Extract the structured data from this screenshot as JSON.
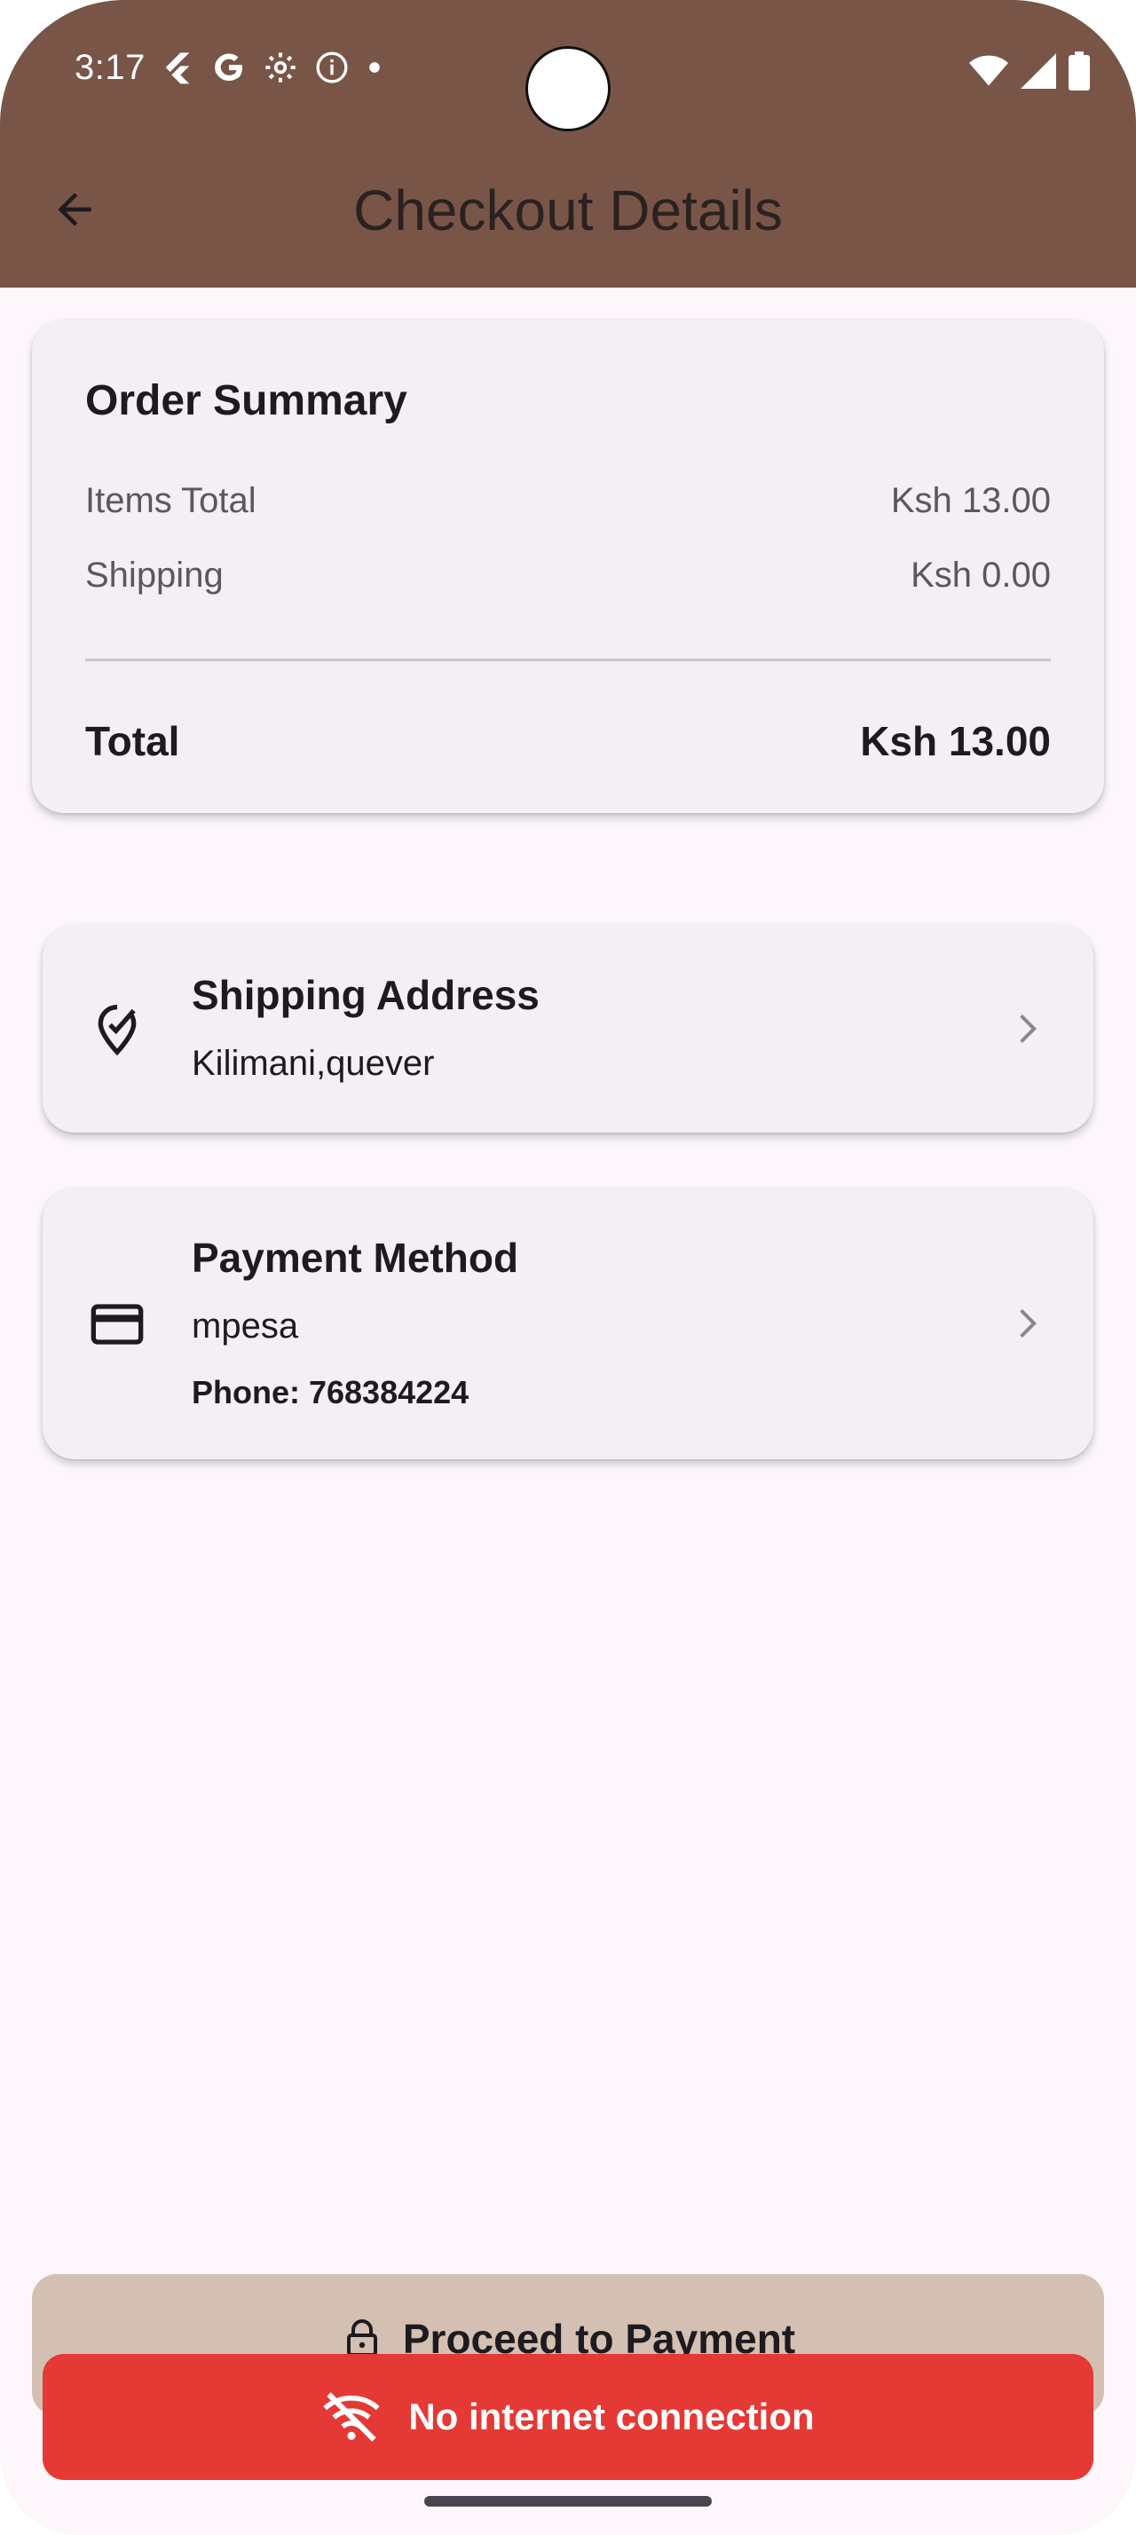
{
  "status_bar": {
    "time": "3:17",
    "left_icons": [
      "flutter-icon",
      "google-icon",
      "settings-icon",
      "info-icon",
      "dot-icon"
    ],
    "right_icons": [
      "wifi-icon",
      "signal-icon",
      "battery-icon"
    ]
  },
  "app_bar": {
    "title": "Checkout Details",
    "background": "#795548",
    "back_icon": "arrow-back-icon"
  },
  "order_summary": {
    "title": "Order Summary",
    "items_total_label": "Items Total",
    "items_total_value": "Ksh 13.00",
    "shipping_label": "Shipping",
    "shipping_value": "Ksh 0.00",
    "total_label": "Total",
    "total_value": "Ksh 13.00"
  },
  "shipping_address": {
    "title": "Shipping Address",
    "value": "Kilimani,quever",
    "icon": "location-pin-icon"
  },
  "payment_method": {
    "title": "Payment Method",
    "value": "mpesa",
    "phone": "Phone: 768384224",
    "icon": "credit-card-icon"
  },
  "proceed_button": {
    "label": "Proceed to Payment",
    "icon": "lock-icon"
  },
  "snackbar": {
    "message": "No internet connection",
    "icon": "wifi-off-icon",
    "color": "#e53935"
  }
}
